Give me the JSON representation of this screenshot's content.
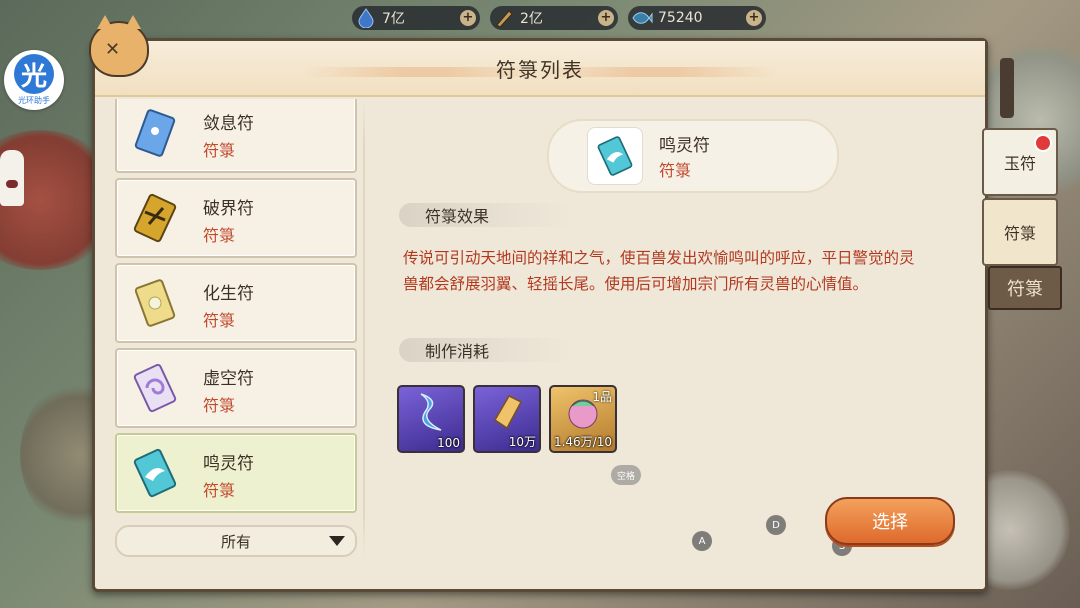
{
  "resources": [
    {
      "icon": "water-drop-icon",
      "value": "7亿"
    },
    {
      "icon": "scroll-feather-icon",
      "value": "2亿"
    },
    {
      "icon": "fish-icon",
      "value": "75240"
    }
  ],
  "helper": {
    "glyph": "光",
    "label": "光环助手"
  },
  "panel": {
    "title": "符箓列表"
  },
  "list": [
    {
      "name": "敛息符",
      "category": "符箓",
      "icon": "blue-talisman-icon",
      "color": "#6aa6e8"
    },
    {
      "name": "破界符",
      "category": "符箓",
      "icon": "golden-break-talisman-icon",
      "color": "#d6a62c"
    },
    {
      "name": "化生符",
      "category": "符箓",
      "icon": "yellow-flower-talisman-icon",
      "color": "#e6cf6c"
    },
    {
      "name": "虚空符",
      "category": "符箓",
      "icon": "purple-swirl-talisman-icon",
      "color": "#a27bd8"
    },
    {
      "name": "鸣灵符",
      "category": "符箓",
      "icon": "cyan-bird-talisman-icon",
      "color": "#52c7d6",
      "selected": true
    }
  ],
  "filter": {
    "label": "所有"
  },
  "detail": {
    "name": "鸣灵符",
    "category": "符箓",
    "effect_title": "符箓效果",
    "effect_text": "传说可引动天地间的祥和之气，使百兽发出欢愉鸣叫的呼应，平日警觉的灵兽都会舒展羽翼、轻摇长尾。使用后可增加宗门所有灵兽的心情值。",
    "cost_title": "制作消耗",
    "costs": [
      {
        "icon": "blue-ink-stroke-icon",
        "qty": "100",
        "bg": "purple"
      },
      {
        "icon": "golden-paper-icon",
        "qty": "10万",
        "bg": "purple"
      },
      {
        "icon": "spirit-peach-icon",
        "qty": "1.46万/10",
        "bg": "gold",
        "grade": "1品"
      }
    ]
  },
  "overlay": {
    "space": "空格",
    "key_a": "A",
    "key_d": "D",
    "key_s": "S"
  },
  "select_button": "选择",
  "tabs": [
    {
      "label": "玉符",
      "badge": true
    },
    {
      "label": "符箓",
      "badge": false
    }
  ],
  "sign": "符箓"
}
